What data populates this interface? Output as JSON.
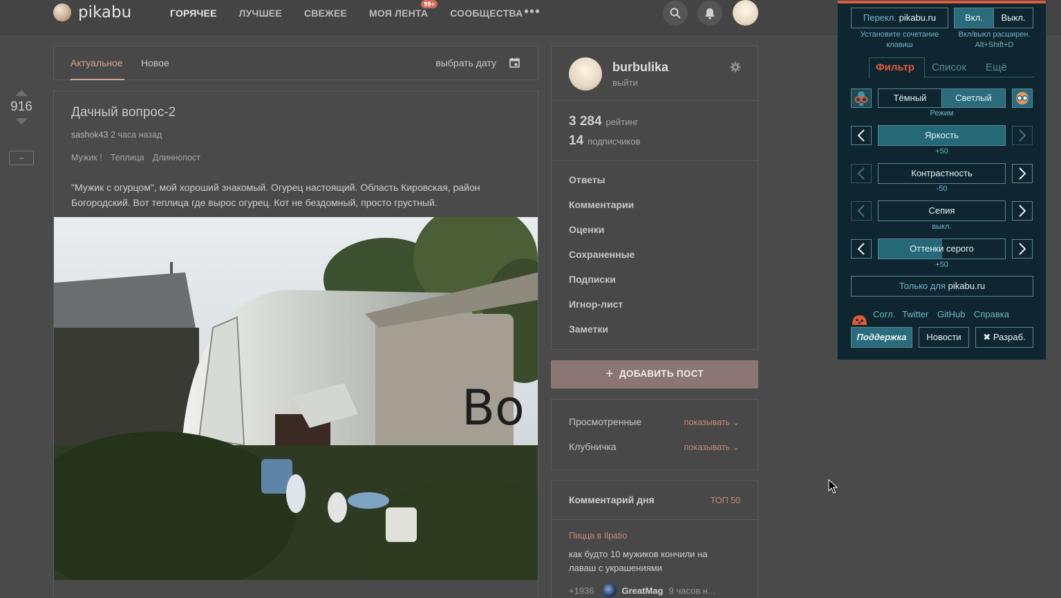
{
  "header": {
    "logo_text": "pikabu",
    "nav": [
      {
        "label": "ГОРЯЧЕЕ"
      },
      {
        "label": "ЛУЧШЕЕ"
      },
      {
        "label": "СВЕЖЕЕ"
      },
      {
        "label": "МОЯ ЛЕНТА",
        "badge": "99+"
      },
      {
        "label": "СООБЩЕСТВА"
      }
    ],
    "more": "•••",
    "icons": [
      "search-icon",
      "bell-icon",
      "avatar"
    ]
  },
  "vote": {
    "count": "916",
    "collapse": "–"
  },
  "tabs": {
    "items": [
      {
        "label": "Актуальное"
      },
      {
        "label": "Новое"
      }
    ],
    "date_label": "выбрать дату"
  },
  "post": {
    "title": "Дачный вопрос-2",
    "author": "sashok43",
    "time": "2 часа назад",
    "tags": [
      "Мужик !",
      "Теплица",
      "Длиннопост"
    ],
    "text": "\"Мужик с огурцом\", мой хороший знакомый. Огурец настоящий. Область Кировская, район Богородский. Вот теплица где вырос огурец. Кот не бездомный, просто грустный."
  },
  "profile": {
    "name": "burbulika",
    "exit": "выйти",
    "rating_value": "3 284",
    "rating_label": "рейтинг",
    "subs_value": "14",
    "subs_label": "подписчиков",
    "menu": [
      "Ответы",
      "Комментарии",
      "Оценки",
      "Сохраненные",
      "Подписки",
      "Игнор-лист",
      "Заметки"
    ]
  },
  "add_post": "ДОБАВИТЬ ПОСТ",
  "filters": [
    {
      "label": "Просмотренные",
      "action": "показывать"
    },
    {
      "label": "Клубничка",
      "action": "показывать"
    }
  ],
  "comment_of_day": {
    "title": "Комментарий дня",
    "top": "ТОП 50",
    "post": "Пицца в Ilpatio",
    "text": "как будто 10 мужиков кончили на лаваш с украшениями",
    "score": "+1936",
    "user": "GreatMag",
    "time": "9 часов н..."
  },
  "extension": {
    "switch_label": "Перекл.",
    "switch_site": "pikabu.ru",
    "on": "Вкл.",
    "off": "Выкл.",
    "hint_keys": "Установите сочетание клавиш",
    "hint_toggle": "Вкл/выкл расширен. Alt+Shift+D",
    "tabs": [
      "Фильтр",
      "Список",
      "Ещё"
    ],
    "mode_dark": "Тёмный",
    "mode_light": "Светлый",
    "mode_label": "Режим",
    "sliders": [
      {
        "label": "Яркость",
        "value": "+50",
        "level": 1.0
      },
      {
        "label": "Контрастность",
        "value": "-50",
        "level": 0.0
      },
      {
        "label": "Сепия",
        "value": "выкл.",
        "level": 0.0
      },
      {
        "label": "Оттенки серого",
        "value": "+50",
        "level": 0.5
      }
    ],
    "only_for": "Только для",
    "only_site": "pikabu.ru",
    "links": [
      "Согл.",
      "Twitter",
      "GitHub",
      "Справка"
    ],
    "support": "Поддержка",
    "news": "Новости",
    "dev": "Разраб.",
    "dev_icon": "wrench-icon"
  },
  "colors": {
    "accent": "#d9a394",
    "ext_bg": "#0f2630",
    "ext_accent": "#e25a3a",
    "ext_blue": "#6fb5c8"
  }
}
